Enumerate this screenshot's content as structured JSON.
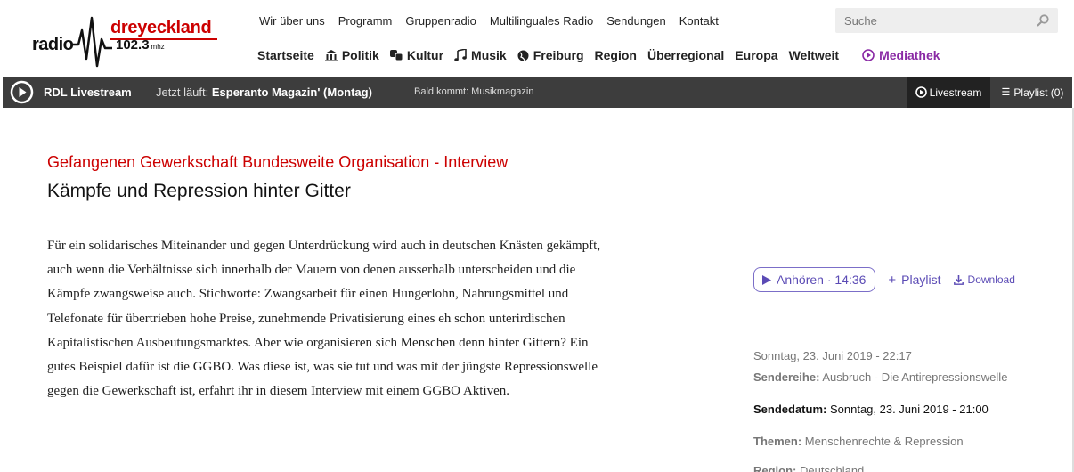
{
  "logo": {
    "radio": "radio",
    "name": "dreyeckland",
    "freq": "102.3",
    "unit": "mhz"
  },
  "topnav": [
    "Wir über uns",
    "Programm",
    "Gruppenradio",
    "Multilinguales Radio",
    "Sendungen",
    "Kontakt"
  ],
  "search": {
    "placeholder": "Suche"
  },
  "mainnav": {
    "startseite": "Startseite",
    "politik": "Politik",
    "kultur": "Kultur",
    "musik": "Musik",
    "freiburg": "Freiburg",
    "region": "Region",
    "ueberregional": "Überregional",
    "europa": "Europa",
    "weltweit": "Weltweit",
    "mediathek": "Mediathek"
  },
  "livebar": {
    "title": "RDL Livestream",
    "now_prefix": "Jetzt läuft:",
    "now_show": "Esperanto Magazin' (Montag)",
    "next": "Bald kommt: Musikmagazin",
    "livestream_tab": "Livestream",
    "playlist_tab": "Playlist (0)"
  },
  "article": {
    "kicker": "Gefangenen Gewerkschaft Bundesweite Organisation - Interview",
    "title": "Kämpfe und Repression hinter Gitter",
    "body": "Für ein solidarisches Miteinander und gegen Unterdrückung wird auch in deutschen Knästen gekämpft, auch wenn die Verhältnisse sich innerhalb der Mauern von denen ausserhalb unterscheiden und die Kämpfe zwangsweise auch. Stichworte: Zwangsarbeit für einen Hungerlohn, Nahrungsmittel und Telefonate für übertrieben hohe Preise, zunehmende Privatisierung eines eh schon unterirdischen Kapitalistischen Ausbeutungsmarktes. Aber wie organisieren sich Menschen denn hinter Gittern? Ein gutes Beispiel dafür ist die GGBO. Was diese ist, was sie tut und was mit der jüngste Repressionswelle gegen die Gewerkschaft ist, erfahrt ihr in diesem Interview mit einem GGBO Aktiven."
  },
  "player": {
    "listen": "Anhören · 14:36",
    "playlist": "Playlist",
    "download": "Download"
  },
  "meta": {
    "date": "Sonntag, 23. Juni 2019 - 22:17",
    "senderreihe_label": "Sendereihe:",
    "senderreihe_value": "Ausbruch - Die Antirepressionswelle",
    "sendedatum_label": "Sendedatum:",
    "sendedatum_value": "Sonntag, 23. Juni 2019 - 21:00",
    "themen_label": "Themen:",
    "themen_value": "Menschenrechte & Repression",
    "region_label": "Region:",
    "region_value": "Deutschland"
  },
  "colors": {
    "brand_red": "#cc0000",
    "link_purple": "#5b4bb5",
    "mediathek_purple": "#8a2aa5",
    "livebar_bg": "#3d3d3d"
  }
}
